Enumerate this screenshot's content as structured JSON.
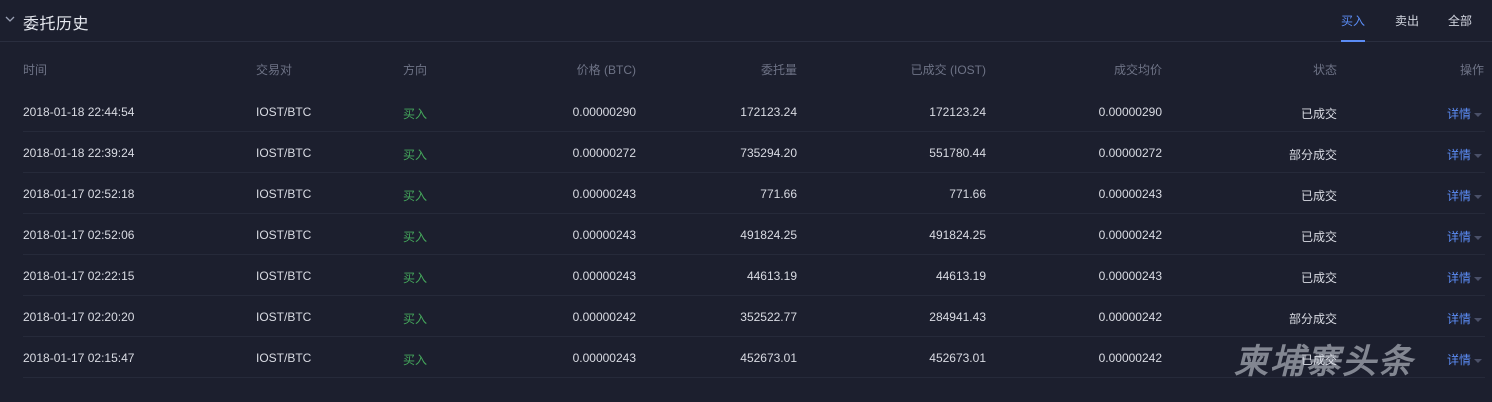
{
  "panel": {
    "title": "委托历史",
    "collapse_icon": "chevron-down-icon",
    "tabs": [
      {
        "label": "买入",
        "active": true
      },
      {
        "label": "卖出",
        "active": false
      },
      {
        "label": "全部",
        "active": false
      }
    ],
    "accent_color": "#5b8cf5",
    "buy_color": "#45a85c"
  },
  "table": {
    "columns": [
      "时间",
      "交易对",
      "方向",
      "价格 (BTC)",
      "委托量",
      "已成交 (IOST)",
      "成交均价",
      "状态",
      "操作"
    ],
    "detail_label": "详情",
    "rows": [
      {
        "time": "2018-01-18 22:44:54",
        "pair": "IOST/BTC",
        "side": "买入",
        "price": "0.00000290",
        "amount": "172123.24",
        "filled": "172123.24",
        "avg": "0.00000290",
        "status": "已成交"
      },
      {
        "time": "2018-01-18 22:39:24",
        "pair": "IOST/BTC",
        "side": "买入",
        "price": "0.00000272",
        "amount": "735294.20",
        "filled": "551780.44",
        "avg": "0.00000272",
        "status": "部分成交"
      },
      {
        "time": "2018-01-17 02:52:18",
        "pair": "IOST/BTC",
        "side": "买入",
        "price": "0.00000243",
        "amount": "771.66",
        "filled": "771.66",
        "avg": "0.00000243",
        "status": "已成交"
      },
      {
        "time": "2018-01-17 02:52:06",
        "pair": "IOST/BTC",
        "side": "买入",
        "price": "0.00000243",
        "amount": "491824.25",
        "filled": "491824.25",
        "avg": "0.00000242",
        "status": "已成交"
      },
      {
        "time": "2018-01-17 02:22:15",
        "pair": "IOST/BTC",
        "side": "买入",
        "price": "0.00000243",
        "amount": "44613.19",
        "filled": "44613.19",
        "avg": "0.00000243",
        "status": "已成交"
      },
      {
        "time": "2018-01-17 02:20:20",
        "pair": "IOST/BTC",
        "side": "买入",
        "price": "0.00000242",
        "amount": "352522.77",
        "filled": "284941.43",
        "avg": "0.00000242",
        "status": "部分成交"
      },
      {
        "time": "2018-01-17 02:15:47",
        "pair": "IOST/BTC",
        "side": "买入",
        "price": "0.00000243",
        "amount": "452673.01",
        "filled": "452673.01",
        "avg": "0.00000242",
        "status": "已成交"
      }
    ]
  },
  "watermark": "柬埔寨头条"
}
